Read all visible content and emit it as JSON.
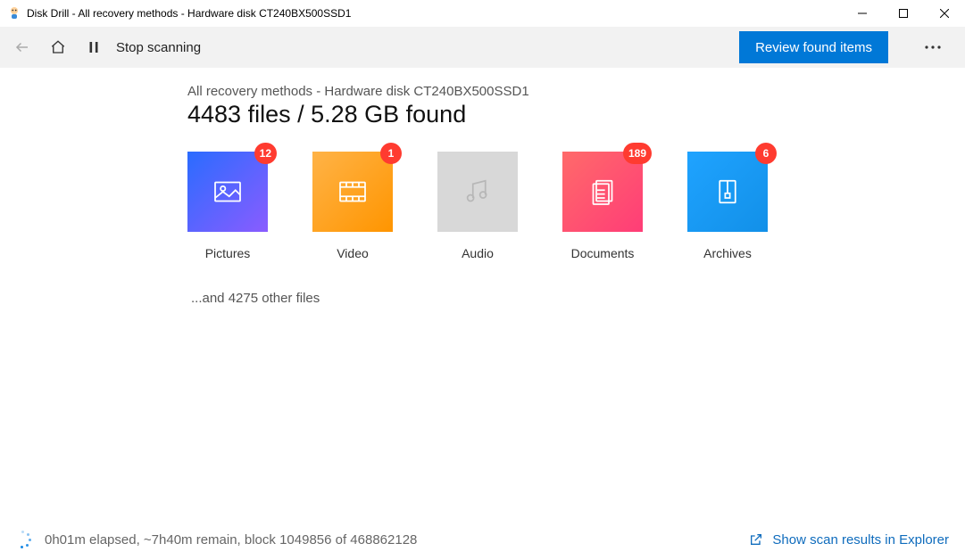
{
  "window": {
    "title": "Disk Drill - All recovery methods - Hardware disk CT240BX500SSD1"
  },
  "toolbar": {
    "stop_label": "Stop scanning",
    "review_label": "Review found items"
  },
  "main": {
    "subtitle": "All recovery methods - Hardware disk CT240BX500SSD1",
    "heading": "4483 files / 5.28 GB found",
    "tiles": [
      {
        "id": "pictures",
        "label": "Pictures",
        "badge": "12"
      },
      {
        "id": "video",
        "label": "Video",
        "badge": "1"
      },
      {
        "id": "audio",
        "label": "Audio",
        "badge": null
      },
      {
        "id": "documents",
        "label": "Documents",
        "badge": "189"
      },
      {
        "id": "archives",
        "label": "Archives",
        "badge": "6"
      }
    ],
    "other_files": "...and 4275 other files"
  },
  "status": {
    "text": "0h01m elapsed, ~7h40m remain, block 1049856 of 468862128",
    "explorer_link": "Show scan results in Explorer"
  }
}
